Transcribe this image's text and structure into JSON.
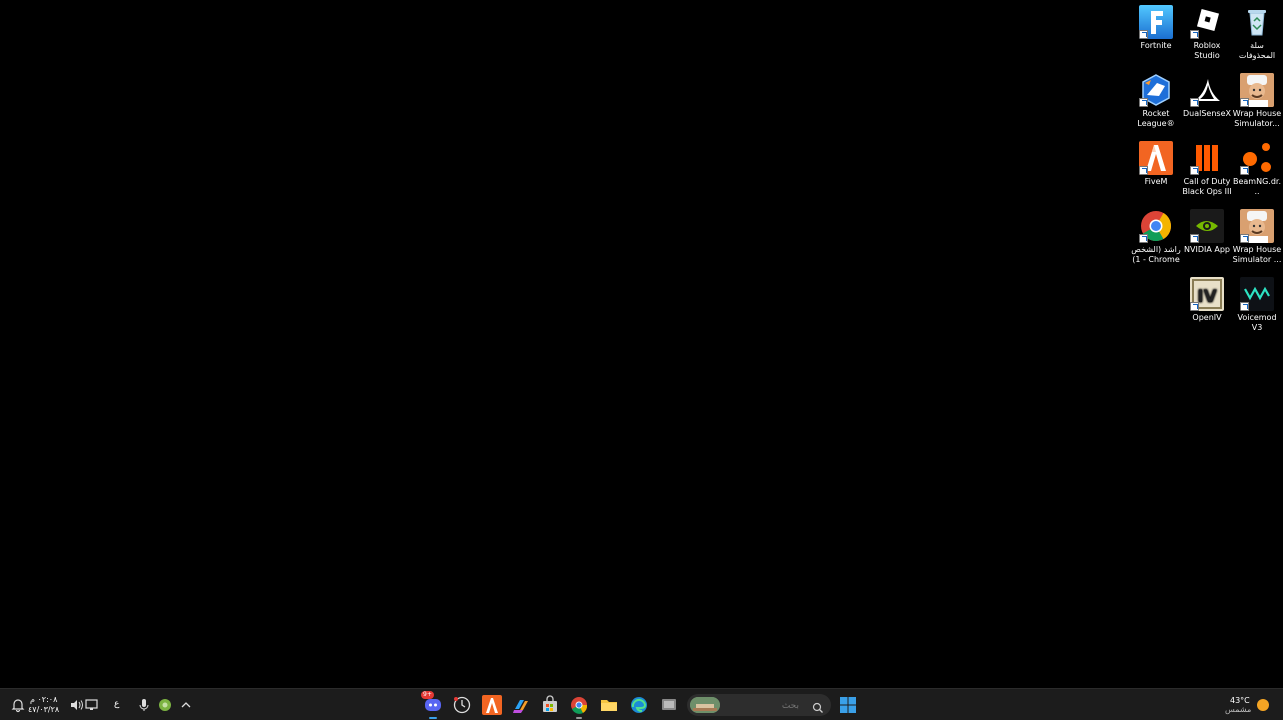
{
  "desktop": {
    "icons": [
      {
        "id": "recycle-bin",
        "label": "سلة المحذوفات",
        "icon": "recycle-bin-icon"
      },
      {
        "id": "roblox-studio",
        "label": "Roblox Studio",
        "icon": "roblox-studio-icon"
      },
      {
        "id": "fortnite",
        "label": "Fortnite",
        "icon": "fortnite-icon"
      },
      {
        "id": "wrap-house-1",
        "label": "Wrap House Simulator...",
        "icon": "wrap-house-icon"
      },
      {
        "id": "dualsensex",
        "label": "DualSenseX",
        "icon": "dualsensex-icon"
      },
      {
        "id": "rocket-league",
        "label": "Rocket League®",
        "icon": "rocket-league-icon"
      },
      {
        "id": "beamng",
        "label": "BeamNG.dr...",
        "icon": "beamng-icon"
      },
      {
        "id": "cod-bo3",
        "label": "Call of Duty Black Ops III",
        "icon": "cod-icon"
      },
      {
        "id": "fivem",
        "label": "FiveM",
        "icon": "fivem-icon"
      },
      {
        "id": "wrap-house-2",
        "label": "Wrap House Simulator ...",
        "icon": "wrap-house-icon"
      },
      {
        "id": "nvidia-app",
        "label": "NVIDIA App",
        "icon": "nvidia-icon"
      },
      {
        "id": "chrome-profile",
        "label": "راشد (الشخص 1) - Chrome",
        "icon": "chrome-icon"
      },
      {
        "id": "voicemod",
        "label": "Voicemod V3",
        "icon": "voicemod-icon"
      },
      {
        "id": "openiv",
        "label": "OpenIV",
        "icon": "openiv-icon"
      }
    ]
  },
  "taskbar": {
    "start_icon": "windows-start-icon",
    "search_placeholder": "بحث",
    "discord_badge": "9+",
    "apps": [
      {
        "id": "discord",
        "icon": "discord-icon"
      },
      {
        "id": "clock-app",
        "icon": "clock-icon"
      },
      {
        "id": "fivem",
        "icon": "fivem-icon"
      },
      {
        "id": "copilot",
        "icon": "copilot-icon"
      },
      {
        "id": "store",
        "icon": "store-icon"
      },
      {
        "id": "chrome",
        "icon": "chrome-icon"
      },
      {
        "id": "file-explorer",
        "icon": "folder-icon"
      },
      {
        "id": "edge",
        "icon": "edge-icon"
      },
      {
        "id": "task-view",
        "icon": "task-view-icon"
      }
    ],
    "weather": {
      "temp": "43°C",
      "condition": "مشمس"
    },
    "tray": {
      "language": "ع",
      "time": "٠٢:٠٨ م",
      "date": "٤٧/٠٣/٢٨"
    }
  },
  "colors": {
    "desktop_bg": "#000000",
    "taskbar_bg": "#1c1c1c",
    "accent": "#3aa0e8"
  }
}
